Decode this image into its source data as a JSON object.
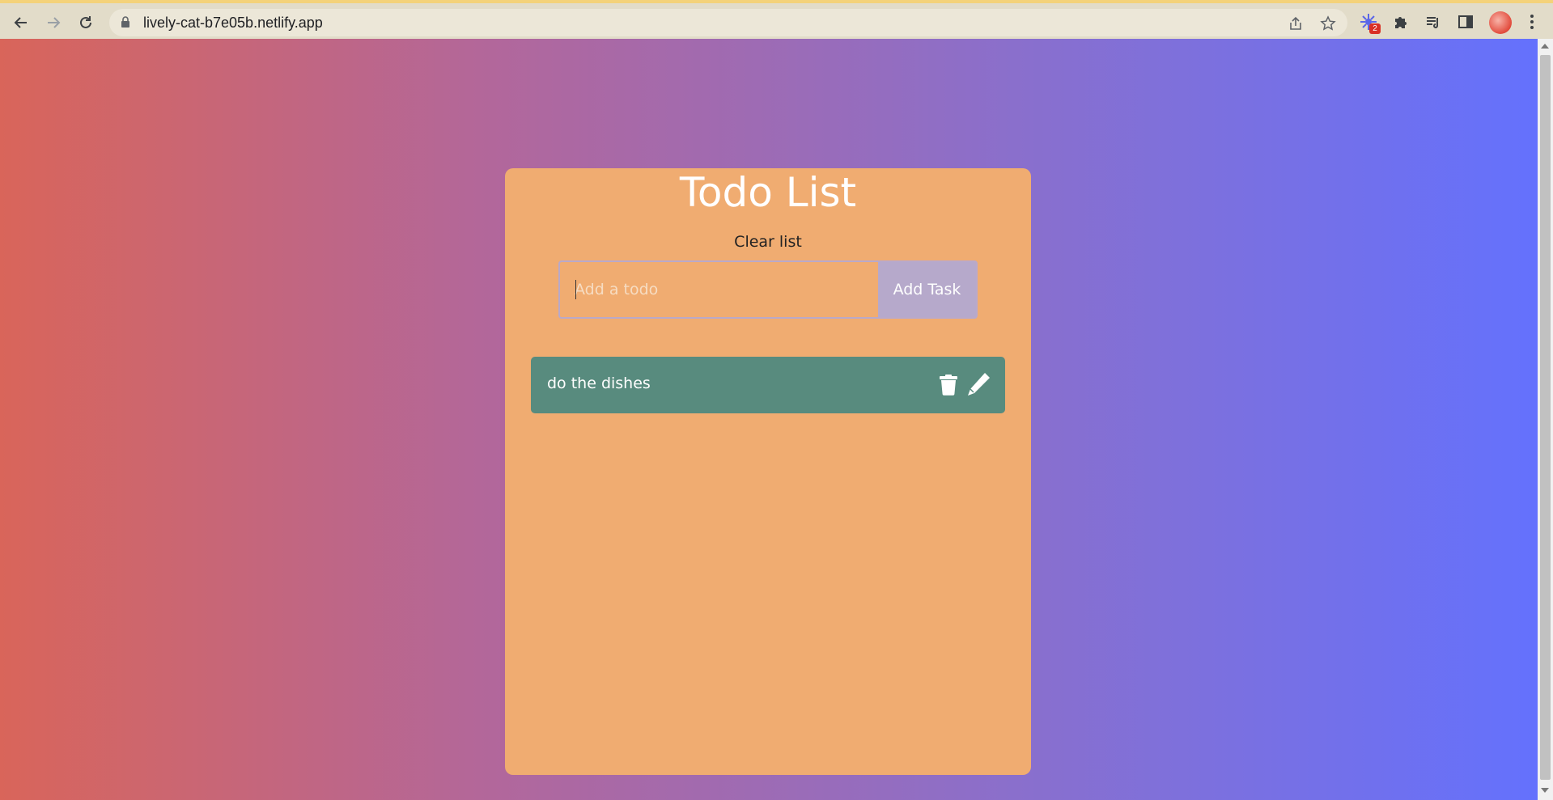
{
  "browser": {
    "url": "lively-cat-b7e05b.netlify.app",
    "extension_badge": "2",
    "icons": {
      "back": "arrow-left-icon",
      "forward": "arrow-right-icon",
      "reload": "reload-icon",
      "lock": "lock-icon",
      "share": "share-icon",
      "bookmark": "star-icon",
      "extension": "color-sparkle-icon",
      "extensions": "puzzle-icon",
      "media": "playlist-icon",
      "sidepanel": "side-panel-icon",
      "menu": "kebab-menu-icon"
    }
  },
  "app": {
    "title": "Todo List",
    "clear_label": "Clear list",
    "input_placeholder": "Add a todo",
    "input_value": "",
    "add_label": "Add Task",
    "todos": [
      {
        "text": "do the dishes",
        "delete_icon": "trash-icon",
        "edit_icon": "pen-icon"
      }
    ]
  },
  "colors": {
    "card": "#f0ac71",
    "todo_item": "#588b7e",
    "add_button": "#b6a9cb",
    "gradient_start": "#d9655a",
    "gradient_end": "#6471fd"
  }
}
